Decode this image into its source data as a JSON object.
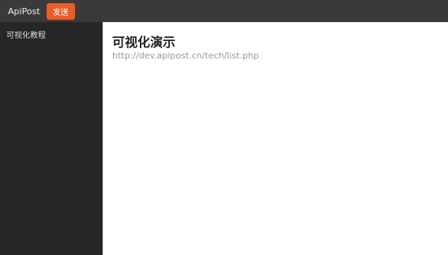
{
  "app": {
    "title": "ApiPost"
  },
  "toolbar": {
    "send": "发送"
  },
  "sidebar": {
    "item": "可视化教程"
  },
  "content": {
    "heading": "可视化演示",
    "url": "http://dev.apipost.cn/tech/list.php"
  }
}
